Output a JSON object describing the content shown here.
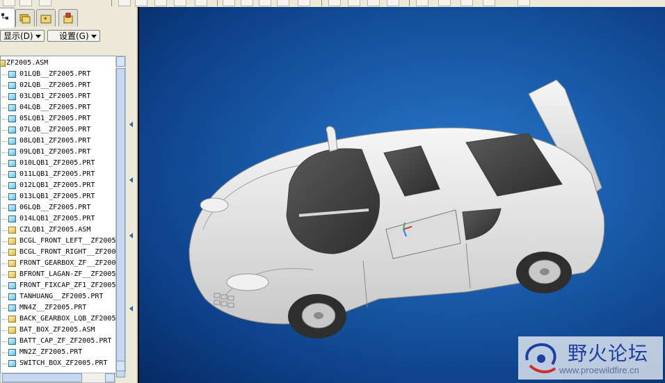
{
  "panel": {
    "menu": {
      "display_label": "显示(D)",
      "settings_label": "设置(G)"
    }
  },
  "tree": {
    "root": "ZF2005.ASM",
    "items": [
      {
        "label": "01LQB__ZF2005.PRT",
        "type": "part"
      },
      {
        "label": "02LQB__ZF2005.PRT",
        "type": "part"
      },
      {
        "label": "03LQB1_ZF2005.PRT",
        "type": "part"
      },
      {
        "label": "04LQB__ZF2005.PRT",
        "type": "part"
      },
      {
        "label": "05LQB1_ZF2005.PRT",
        "type": "part"
      },
      {
        "label": "07LQB__ZF2005.PRT",
        "type": "part"
      },
      {
        "label": "08LQB1_ZF2005.PRT",
        "type": "part"
      },
      {
        "label": "09LQB1_ZF2005.PRT",
        "type": "part"
      },
      {
        "label": "010LQB1_ZF2005.PRT",
        "type": "part"
      },
      {
        "label": "011LQB1_ZF2005.PRT",
        "type": "part"
      },
      {
        "label": "012LQB1_ZF2005.PRT",
        "type": "part"
      },
      {
        "label": "013LQB1_ZF2005.PRT",
        "type": "part"
      },
      {
        "label": "06LQB__ZF2005.PRT",
        "type": "part"
      },
      {
        "label": "014LQB1_ZF2005.PRT",
        "type": "part"
      },
      {
        "label": "CZLQB1_ZF2005.ASM",
        "type": "asm"
      },
      {
        "label": "BCGL_FRONT_LEFT__ZF2005",
        "type": "asm"
      },
      {
        "label": "BCGL_FRONT_RIGHT__ZF200",
        "type": "asm"
      },
      {
        "label": "FRONT_GEARBOX_ZF__ZF200",
        "type": "asm"
      },
      {
        "label": "BFRONT_LAGAN-ZF__ZF2005",
        "type": "asm"
      },
      {
        "label": "FRONT_FIXCAP_ZF1_ZF2005",
        "type": "part"
      },
      {
        "label": "TANHUANG__ZF2005.PRT",
        "type": "part"
      },
      {
        "label": "MN4Z__ZF2005.PRT",
        "type": "part"
      },
      {
        "label": "BACK_GEARBOX_LQB_ZF2005",
        "type": "asm"
      },
      {
        "label": "BAT_BOX_ZF2005.ASM",
        "type": "asm"
      },
      {
        "label": "BATT_CAP_ZF_ZF2005.PRT",
        "type": "part"
      },
      {
        "label": "MN2Z_ZF2005.PRT",
        "type": "part"
      },
      {
        "label": "SWITCH_BOX_ZF2005.PRT",
        "type": "part"
      }
    ]
  },
  "watermark": {
    "title": "野火论坛",
    "url": "www.proewildfire.cn"
  },
  "colors": {
    "viewport_bg": "#1b5fae",
    "model": "#e6e6e6",
    "accent": "#1d3fa0"
  }
}
